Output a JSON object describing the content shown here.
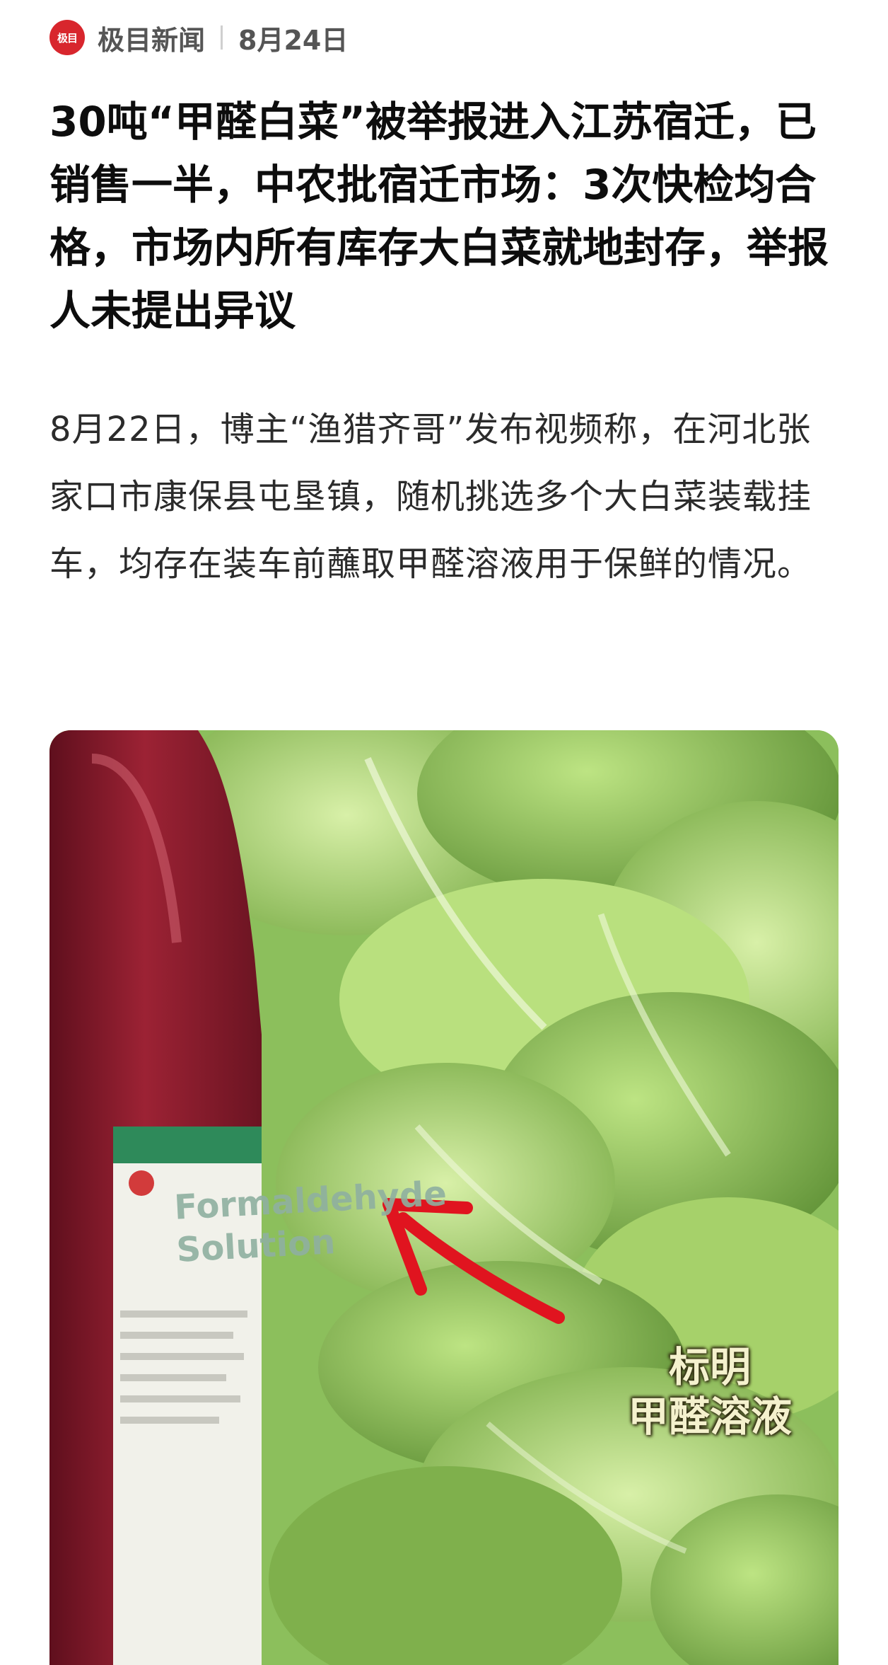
{
  "source": {
    "logo_text": "极目",
    "name": "极目新闻",
    "date": "8月24日"
  },
  "article": {
    "headline": "30吨“甲醛白菜”被举报进入江苏宿迁，已销售一半，中农批宿迁市场：3次快检均合格，市场内所有库存大白菜就地封存，举报人未提出异议",
    "body": "8月22日，博主“渔猎齐哥”发布视频称，在河北张家口市康保县屯垦镇，随机挑选多个大白菜装载挂车，均存在装车前蘸取甲醛溶液用于保鲜的情况。"
  },
  "photo": {
    "bottle_label_line1": "Formaldehyde",
    "bottle_label_line2": "Solution",
    "caption_line1": "标明",
    "caption_line2": "甲醛溶液",
    "colors": {
      "bottle_red": "#8e1b2c",
      "cabbage_green": "#9fcf6a",
      "arrow_red": "#e0141f"
    }
  }
}
